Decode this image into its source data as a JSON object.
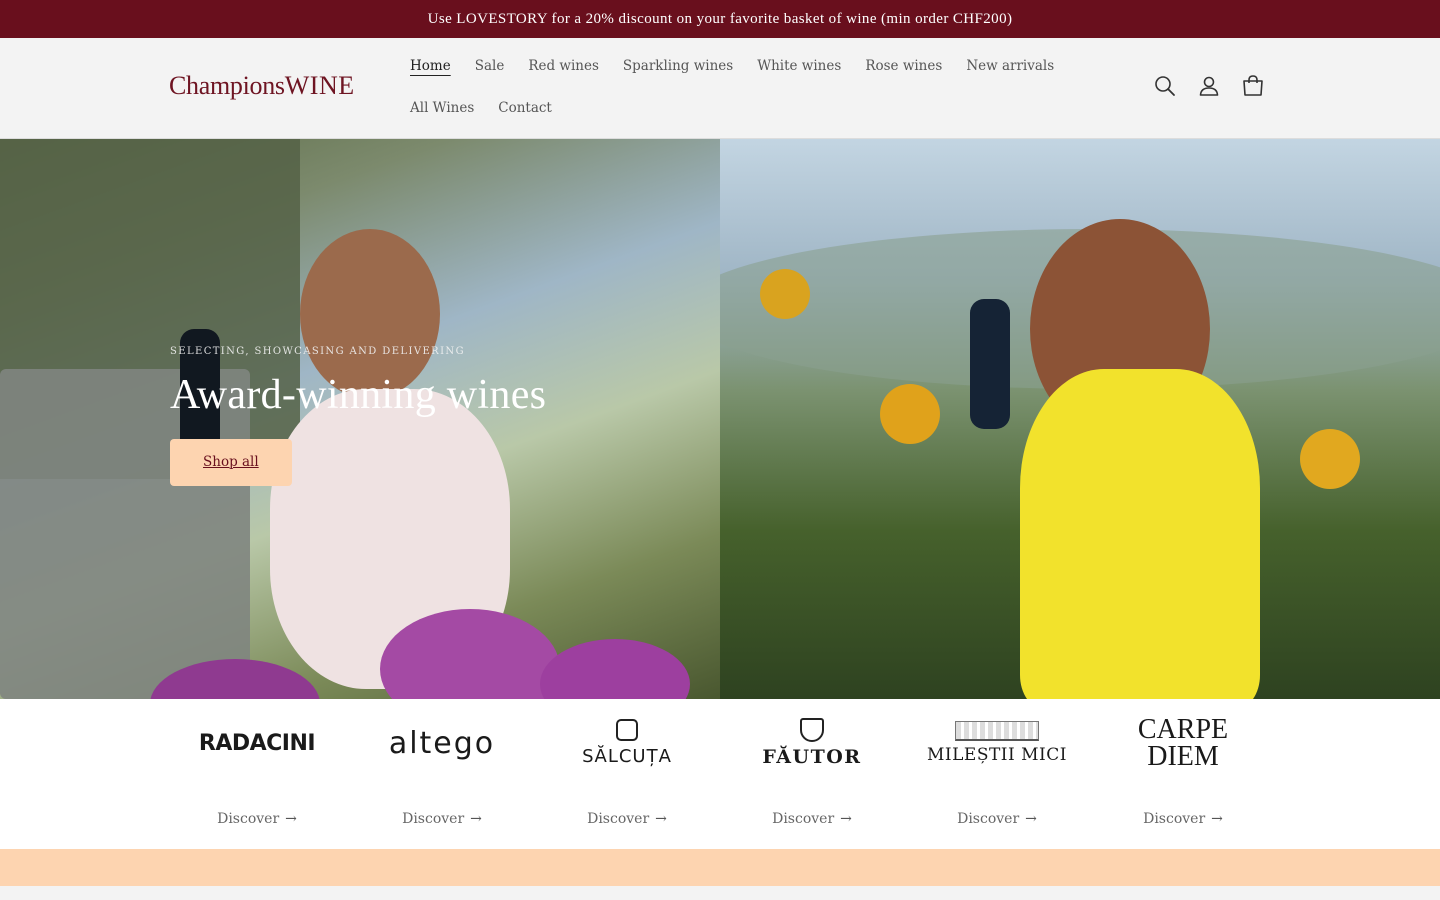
{
  "announcement": "Use LOVESTORY for a 20% discount on your favorite basket of wine (min order CHF200)",
  "logo": {
    "part1": "Champions",
    "part2": "WINE"
  },
  "nav": [
    {
      "label": "Home",
      "active": true
    },
    {
      "label": "Sale"
    },
    {
      "label": "Red wines"
    },
    {
      "label": "Sparkling wines"
    },
    {
      "label": "White wines"
    },
    {
      "label": "Rose wines"
    },
    {
      "label": "New arrivals"
    },
    {
      "label": "All Wines"
    },
    {
      "label": "Contact"
    }
  ],
  "icons": [
    "search-icon",
    "account-icon",
    "cart-icon"
  ],
  "hero": {
    "eyebrow": "SELECTING, SHOWCASING AND DELIVERING",
    "title": "Award-winning wines",
    "button": "Shop all"
  },
  "brands": [
    {
      "name": "RADACINI",
      "cta": "Discover"
    },
    {
      "name": "altego",
      "cta": "Discover"
    },
    {
      "name": "SĂLCUȚA",
      "cta": "Discover"
    },
    {
      "name": "FĂUTOR",
      "cta": "Discover"
    },
    {
      "name": "MILEȘTII MICI",
      "cta": "Discover"
    },
    {
      "name": "CARPE DIEM",
      "cta": "Discover"
    }
  ],
  "colors": {
    "brand": "#690f1d",
    "accent": "#fdd4b0"
  }
}
